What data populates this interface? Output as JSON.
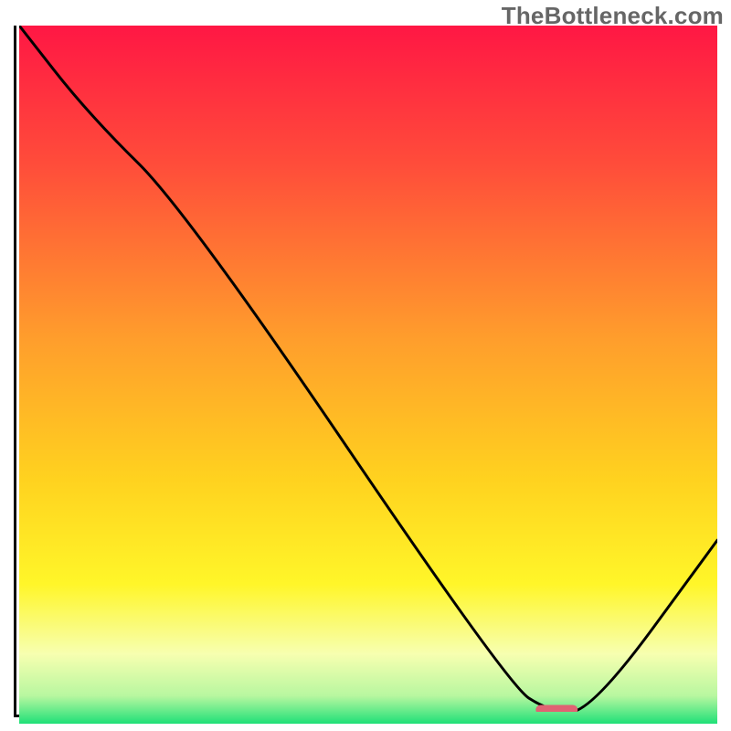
{
  "watermark": "TheBottleneck.com",
  "chart_data": {
    "type": "line",
    "title": "",
    "xlabel": "",
    "ylabel": "",
    "xlim": [
      0,
      100
    ],
    "ylim": [
      0,
      100
    ],
    "grid": false,
    "legend": false,
    "series": [
      {
        "name": "curve",
        "x": [
          0,
          10,
          24,
          70,
          76,
          82,
          100
        ],
        "y": [
          100,
          87,
          73,
          4,
          0,
          0,
          25
        ]
      }
    ],
    "marker": {
      "name": "optimal-point",
      "x_range": [
        74,
        80
      ],
      "y": 0,
      "color": "#e06373"
    },
    "gradient_stops": [
      {
        "offset": 0,
        "color": "#ff1744"
      },
      {
        "offset": 20,
        "color": "#ff4d3a"
      },
      {
        "offset": 45,
        "color": "#ff9e2c"
      },
      {
        "offset": 65,
        "color": "#ffd21f"
      },
      {
        "offset": 80,
        "color": "#fff629"
      },
      {
        "offset": 90,
        "color": "#f7ffb0"
      },
      {
        "offset": 96,
        "color": "#b8f7a0"
      },
      {
        "offset": 100,
        "color": "#20e078"
      }
    ]
  }
}
